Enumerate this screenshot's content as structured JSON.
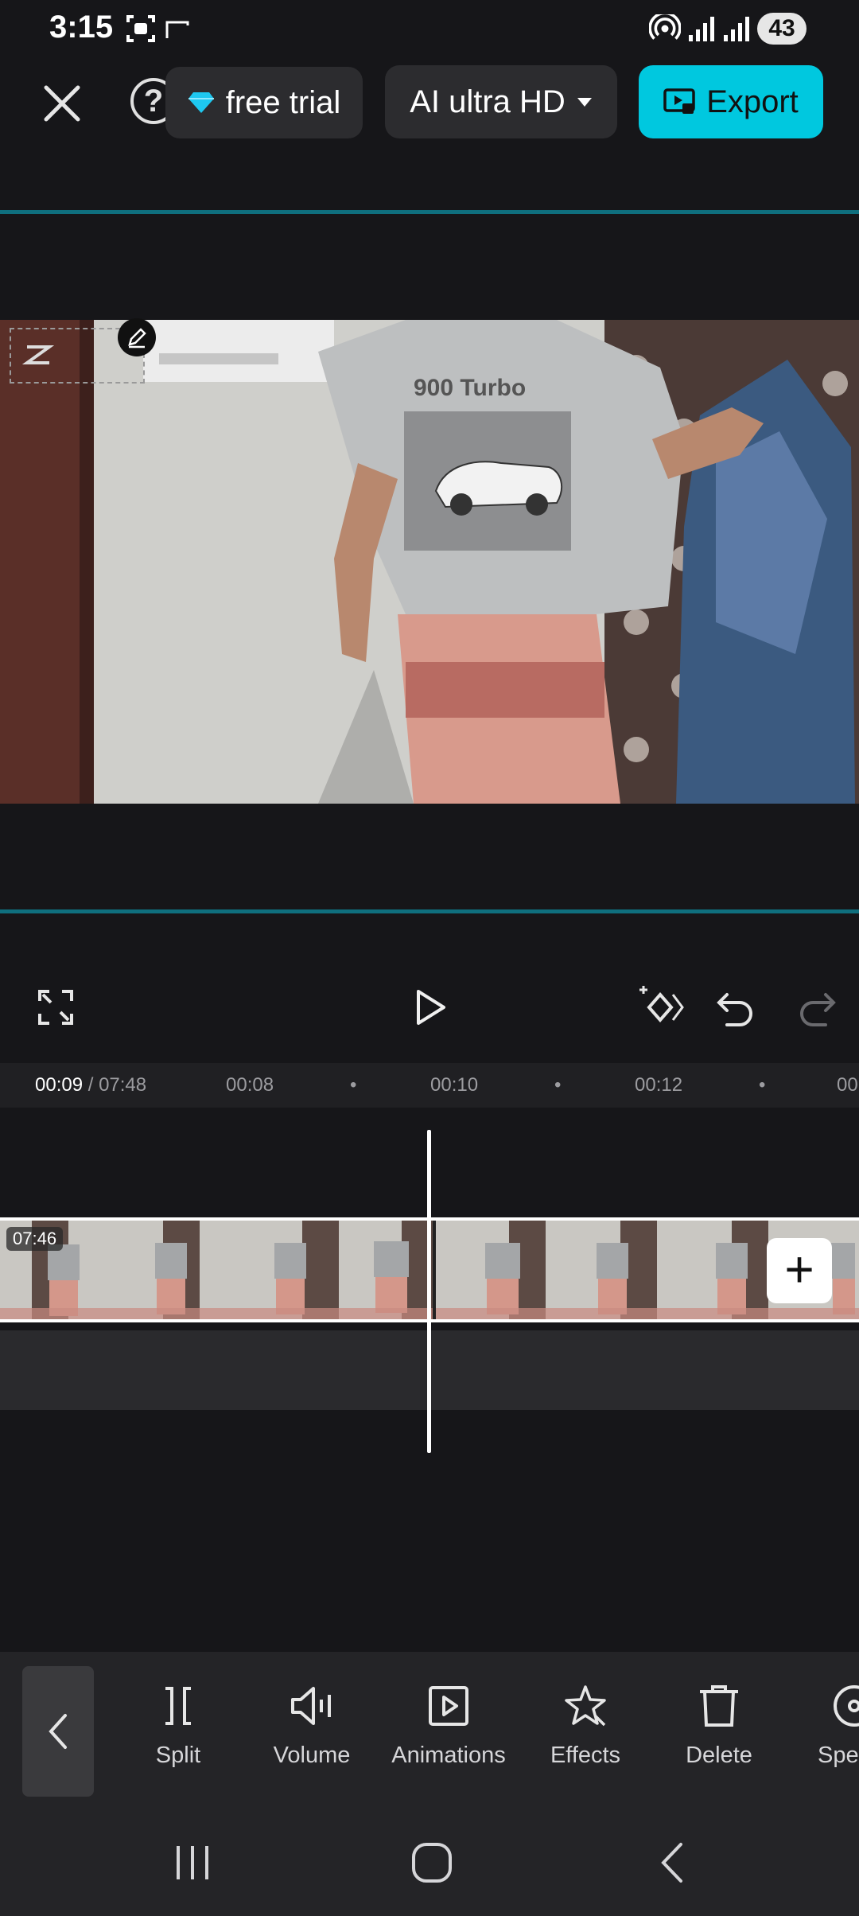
{
  "status_bar": {
    "time": "3:15",
    "battery": "43",
    "icons": [
      "screenshot-icon",
      "cast-icon",
      "hotspot-icon",
      "signal-icon",
      "signal-icon"
    ]
  },
  "top_bar": {
    "close_icon": "close-icon",
    "help_label": "?",
    "trial_label": "free trial",
    "trial_icon": "diamond-icon",
    "quality_label": "AI ultra HD",
    "export_label": "Export",
    "accent_color": "#00c8df"
  },
  "preview": {
    "shirt_text": "900 Turbo"
  },
  "controls": {
    "fullscreen_icon": "fullscreen-icon",
    "play_icon": "play-icon",
    "keyframe_icon": "keyframe-icon",
    "undo_icon": "undo-icon",
    "redo_icon": "redo-icon"
  },
  "timeline": {
    "current_time": "00:09",
    "total_time": "/ 07:48",
    "ticks": [
      "00:08",
      "00:10",
      "00:12",
      "00:"
    ],
    "clip_duration": "07:46",
    "add_label": "+"
  },
  "edit_toolbar": {
    "tools": [
      {
        "label": "Split",
        "icon": "split-icon"
      },
      {
        "label": "Volume",
        "icon": "volume-icon"
      },
      {
        "label": "Animations",
        "icon": "animations-icon"
      },
      {
        "label": "Effects",
        "icon": "effects-icon"
      },
      {
        "label": "Delete",
        "icon": "delete-icon"
      },
      {
        "label": "Spe",
        "icon": "speed-icon"
      }
    ]
  },
  "nav_bar": {
    "icons": [
      "recents-icon",
      "home-icon",
      "back-icon"
    ]
  }
}
